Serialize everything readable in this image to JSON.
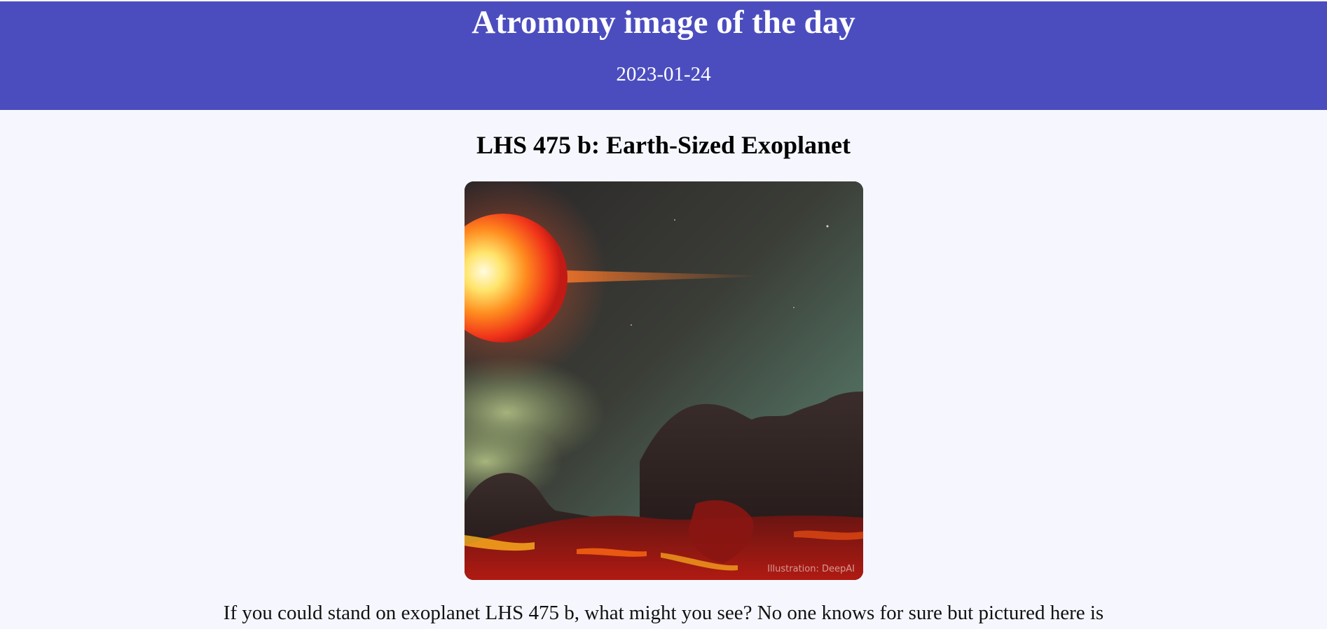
{
  "header": {
    "title": "Atromony image of the day",
    "date": "2023-01-24"
  },
  "article": {
    "title": "LHS 475 b: Earth-Sized Exoplanet",
    "image_alt": "LHS 475 b: Earth-Sized Exoplanet",
    "image_credit": "Illustration: DeepAI",
    "caption": "If you could stand on exoplanet LHS 475 b, what might you see? No one knows for sure but pictured here is"
  },
  "colors": {
    "header_bg": "#4b4dbf",
    "page_bg": "#f6f7fe"
  }
}
